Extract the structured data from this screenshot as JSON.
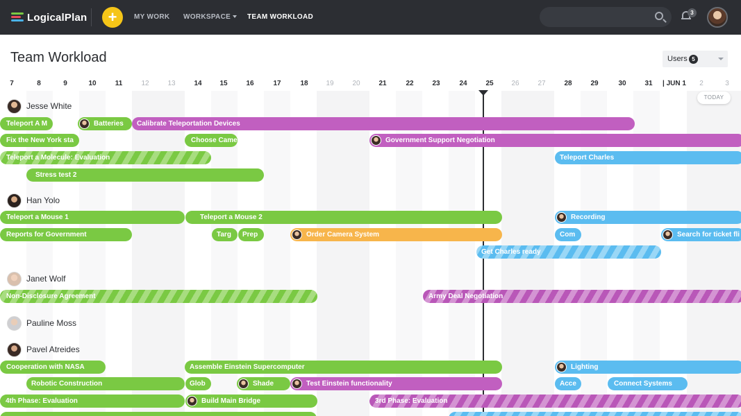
{
  "app": {
    "logo_text": "LogicalPlan"
  },
  "nav": {
    "add_label": "+",
    "my_work": "MY WORK",
    "workspace": "WORKSPACE",
    "team_workload": "TEAM WORKLOAD",
    "notifications_count": "3"
  },
  "page": {
    "title": "Team Workload"
  },
  "filter": {
    "label": "Users",
    "count": "5"
  },
  "timeline": {
    "days": [
      "7",
      "8",
      "9",
      "10",
      "11",
      "12",
      "13",
      "14",
      "15",
      "16",
      "17",
      "18",
      "19",
      "20",
      "21",
      "22",
      "23",
      "24",
      "25",
      "26",
      "27",
      "28",
      "29",
      "30",
      "31",
      "| JUN 1",
      "2",
      "3"
    ],
    "today_label": "TODAY",
    "today": "25"
  },
  "users": [
    {
      "name": "Jesse White"
    },
    {
      "name": "Han Yolo"
    },
    {
      "name": "Janet Wolf"
    },
    {
      "name": "Pauline Moss"
    },
    {
      "name": "Pavel Atreides"
    }
  ],
  "tasks": {
    "t1": "Teleport A M",
    "t2": "Batteries",
    "t3": "Calibrate Teleportation Devices",
    "t4": "Fix the New York sta",
    "t5": "Choose Came",
    "t6": "Government Support Negotiation",
    "t7": "Teleport a Molecule: Evaluation",
    "t8": "Teleport Charles",
    "t9": "Stress test 2",
    "t10": "Teleport a Mouse 1",
    "t11": "Teleport a Mouse 2",
    "t12": "Recording",
    "t13": "Reports for Government",
    "t14": "Targ",
    "t15": "Prep",
    "t16": "Order Camera System",
    "t17": "Com",
    "t18": "Search for ticket fli",
    "t19": "Get Charles ready",
    "t20": "Non-Disclosure Agreement",
    "t21": "Army Deal Negotiation",
    "t22": "Cooperation with NASA",
    "t23": "Assemble Einstein Supercomputer",
    "t24": "Lighting",
    "t25": "Robotic Construction",
    "t26": "Glob",
    "t27": "Shade",
    "t28": "Test Einstein functionality",
    "t29": "Acce",
    "t30": "Connect Systems",
    "t31": "4th Phase: Evaluation",
    "t32": "Build Main Bridge",
    "t33": "3rd Phase: Evaluation"
  },
  "colors": {
    "green": "#7ac943",
    "purple": "#c15fc0",
    "blue": "#5bbcf0",
    "orange": "#f7b54b",
    "topbar": "#2c2e33",
    "accent": "#f5c518"
  }
}
